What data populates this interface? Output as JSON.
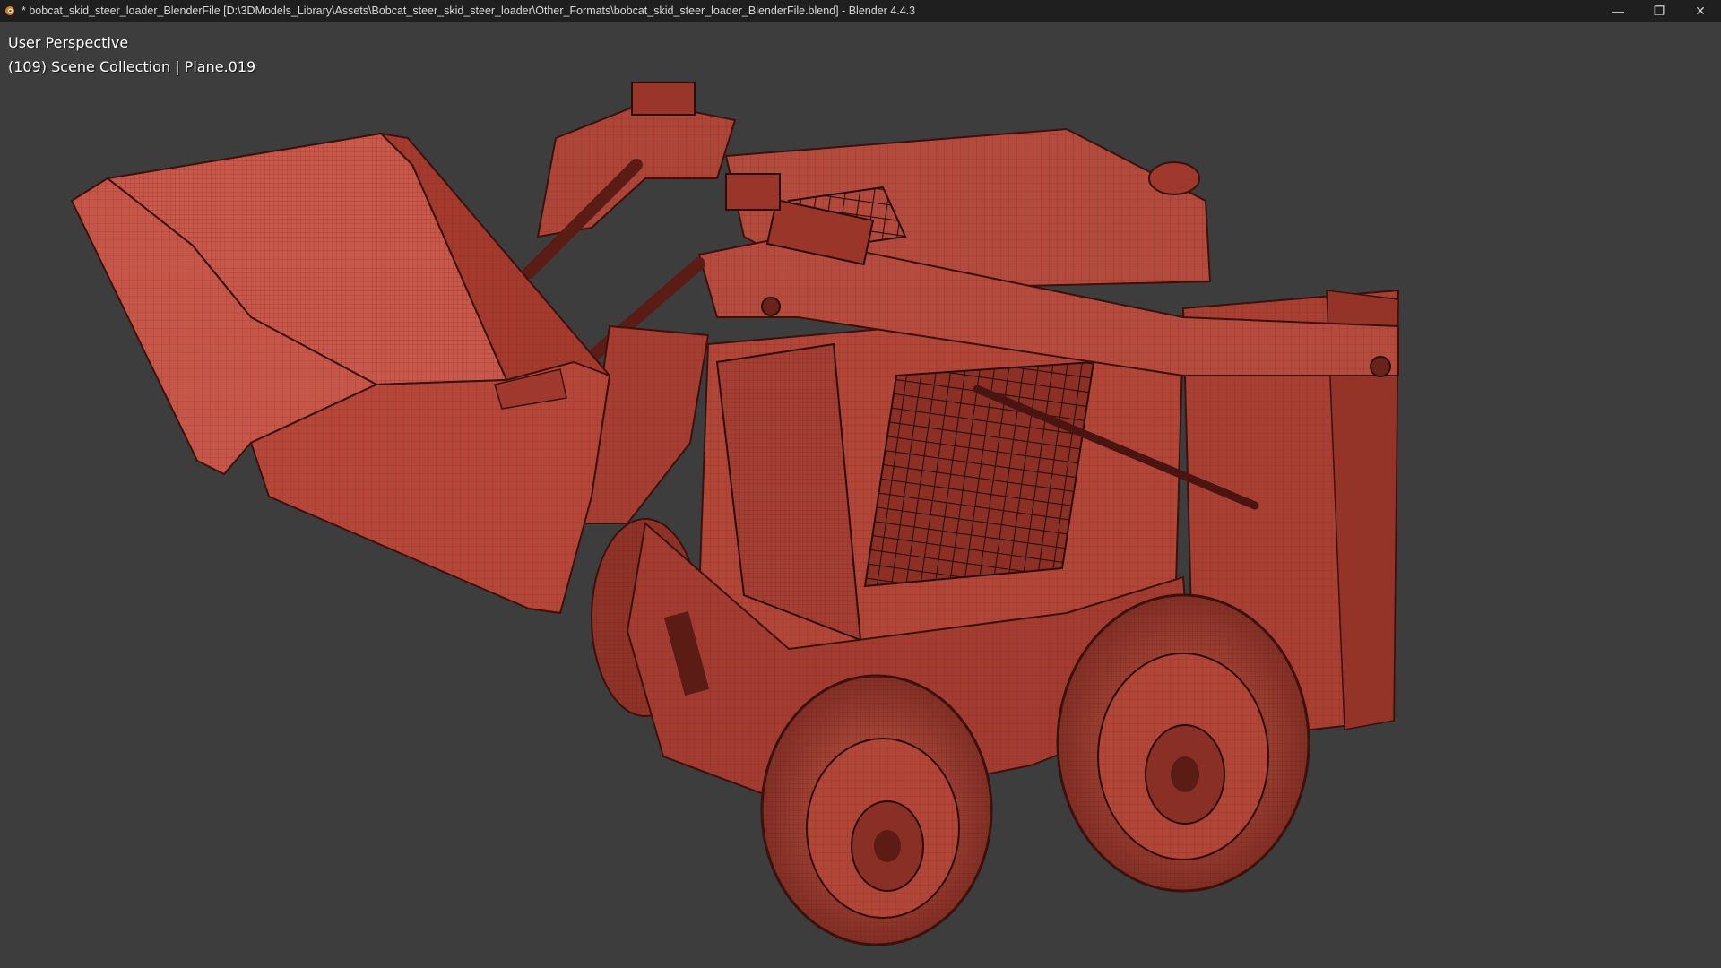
{
  "window": {
    "title": "* bobcat_skid_steer_loader_BlenderFile [D:\\3DModels_Library\\Assets\\Bobcat_steer_skid_steer_loader\\Other_Formats\\bobcat_skid_steer_loader_BlenderFile.blend] - Blender 4.4.3",
    "app_icon": "blender-icon",
    "controls": {
      "minimize": "—",
      "restore": "❐",
      "close": "✕"
    }
  },
  "viewport": {
    "view_name": "User Perspective",
    "collection_info": "(109) Scene Collection | Plane.019",
    "background_color": "#3d3d3d",
    "model_color": "#b5473a"
  }
}
